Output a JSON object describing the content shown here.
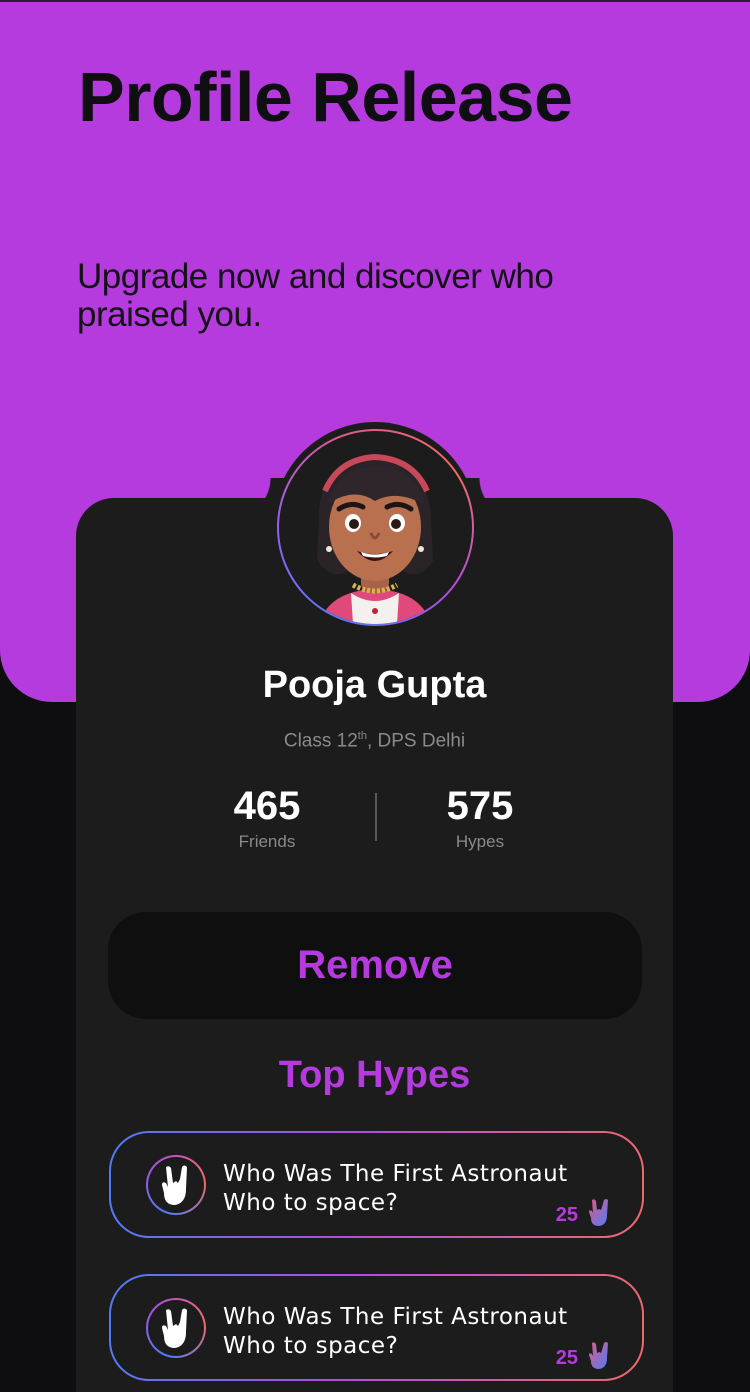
{
  "hero": {
    "title": "Profile Release",
    "subtitle": "Upgrade now and discover who praised you."
  },
  "profile": {
    "name": "Pooja Gupta",
    "class_prefix": "Class 12",
    "class_sup": "th",
    "class_suffix": ", DPS Delhi",
    "avatar_icon": "avatar-girl"
  },
  "stats": {
    "friends_value": "465",
    "friends_label": "Friends",
    "hypes_value": "575",
    "hypes_label": "Hypes"
  },
  "actions": {
    "remove_label": "Remove"
  },
  "top_hypes": {
    "title": "Top Hypes",
    "items": [
      {
        "question": "Who Was The First Astronaut Who to space?",
        "count": "25",
        "icon": "rock-hand-icon"
      },
      {
        "question": "Who Was The First Astronaut Who to space?",
        "count": "25",
        "icon": "rock-hand-icon"
      }
    ]
  },
  "colors": {
    "accent": "#b53bdf",
    "card": "#1c1c1d",
    "background": "#0e0e10",
    "gradient_start": "#4f7cf5",
    "gradient_end": "#f06a6a"
  }
}
